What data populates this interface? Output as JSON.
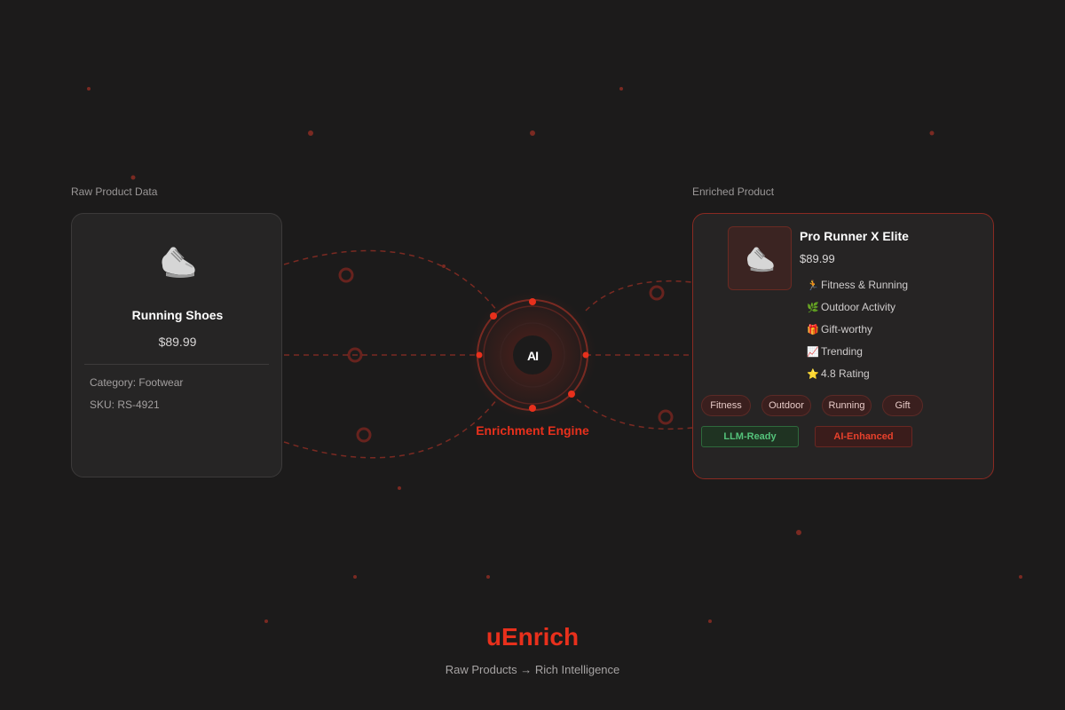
{
  "raw": {
    "section_label": "Raw Product Data",
    "title": "Running Shoes",
    "price": "$89.99",
    "category": "Category: Footwear",
    "sku": "SKU: RS-4921"
  },
  "engine": {
    "mark": "AI",
    "label": "Enrichment Engine"
  },
  "enriched": {
    "section_label": "Enriched Product",
    "title": "Pro Runner X Elite",
    "price": "$89.99",
    "features": [
      {
        "icon": "🏃",
        "label": "Fitness & Running"
      },
      {
        "icon": "🌿",
        "label": "Outdoor Activity"
      },
      {
        "icon": "🎁",
        "label": "Gift-worthy"
      },
      {
        "icon": "📈",
        "label": "Trending"
      },
      {
        "icon": "⭐",
        "label": "4.8 Rating"
      }
    ],
    "tags": [
      "Fitness",
      "Outdoor",
      "Running",
      "Gift"
    ],
    "badges": {
      "llm": "LLM-Ready",
      "ai": "AI-Enhanced"
    }
  },
  "brand": {
    "name": "uEnrich",
    "tagline": "Raw Products → Rich Intelligence"
  },
  "colors": {
    "accent": "#e8301c",
    "background": "#1c1b1b",
    "success": "#54c27a"
  }
}
